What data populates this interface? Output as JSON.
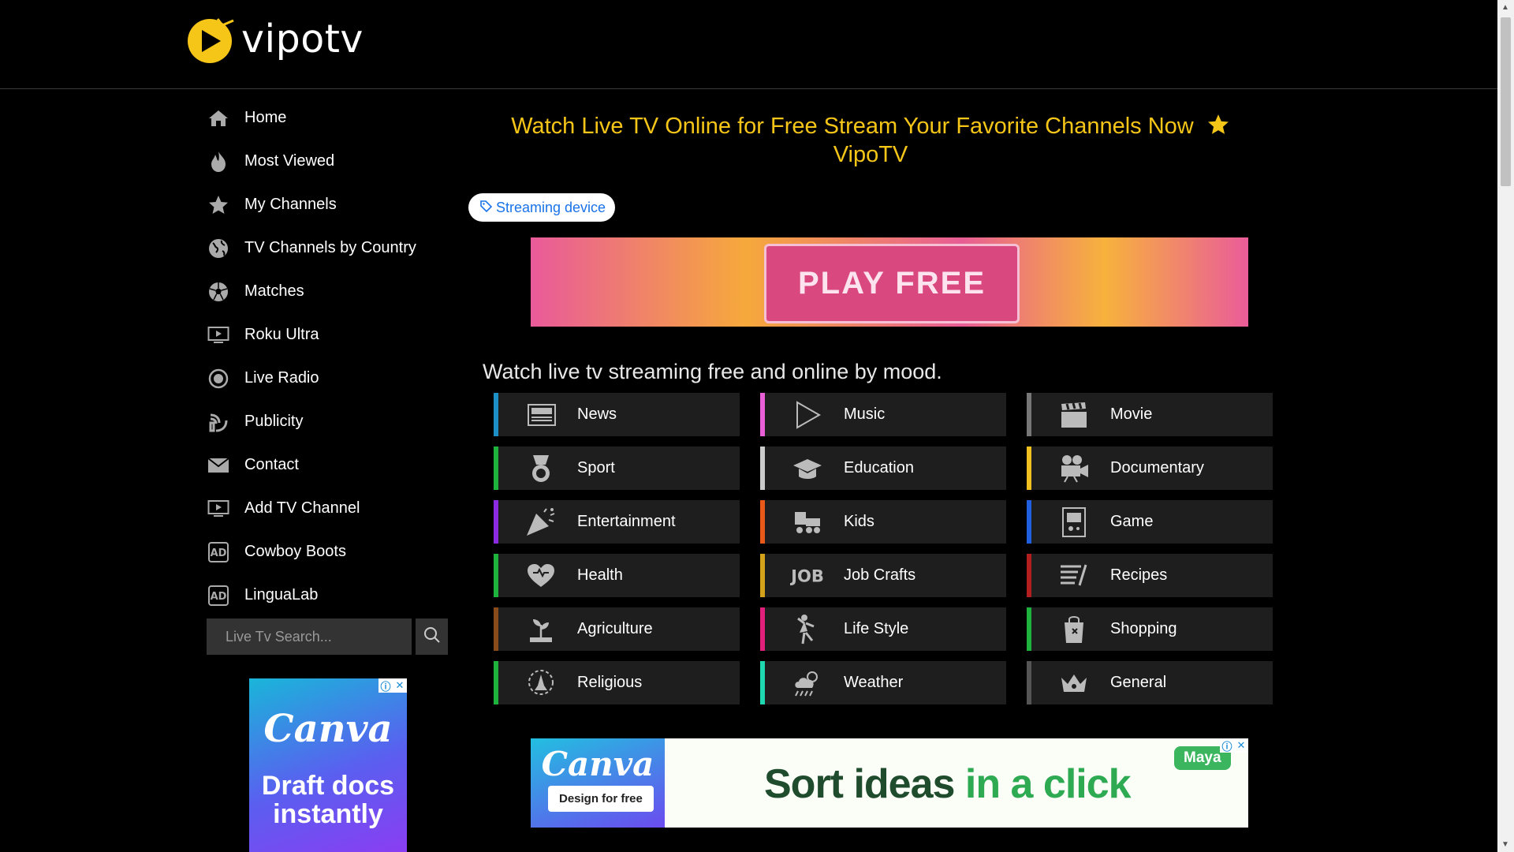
{
  "site": {
    "logo_text": "vipotv"
  },
  "sidebar": {
    "items": [
      {
        "label": "Home",
        "icon": "home-icon"
      },
      {
        "label": "Most Viewed",
        "icon": "fire-icon"
      },
      {
        "label": "My Channels",
        "icon": "star-icon"
      },
      {
        "label": "TV Channels by Country",
        "icon": "globe-icon"
      },
      {
        "label": "Matches",
        "icon": "soccer-ball-icon"
      },
      {
        "label": "Roku Ultra",
        "icon": "tv-play-icon"
      },
      {
        "label": "Live Radio",
        "icon": "radio-icon"
      },
      {
        "label": "Publicity",
        "icon": "publicity-icon"
      },
      {
        "label": "Contact",
        "icon": "envelope-icon"
      },
      {
        "label": "Add TV Channel",
        "icon": "tv-play-icon"
      },
      {
        "label": "Cowboy Boots",
        "icon": "ad-icon"
      },
      {
        "label": "LinguaLab",
        "icon": "ad-icon"
      }
    ]
  },
  "search": {
    "placeholder": "Live Tv Search..."
  },
  "main": {
    "title_line1": "Watch Live TV Online for Free Stream Your Favorite Channels Now",
    "title_line2": "VipoTV",
    "tag_label": "Streaming device",
    "section_title": "Watch live tv streaming free and online by mood."
  },
  "ads": {
    "top_banner_text": "PLAY FREE",
    "side_brand": "Canva",
    "side_text": "Draft docs instantly",
    "bottom_brand": "Canva",
    "bottom_cta": "Design for free",
    "bottom_slogan_a": "Sort ideas",
    "bottom_slogan_b": "in a click",
    "bottom_tag": "Maya"
  },
  "categories": [
    {
      "label": "News",
      "color": "#1e90c8",
      "icon": "newspaper-icon"
    },
    {
      "label": "Music",
      "color": "#e85fd8",
      "icon": "play-triangle-icon"
    },
    {
      "label": "Movie",
      "color": "#777777",
      "icon": "clapperboard-icon"
    },
    {
      "label": "Sport",
      "color": "#1db33c",
      "icon": "medal-icon"
    },
    {
      "label": "Education",
      "color": "#cccccc",
      "icon": "graduation-cap-icon"
    },
    {
      "label": "Documentary",
      "color": "#f0c020",
      "icon": "video-camera-icon"
    },
    {
      "label": "Entertainment",
      "color": "#8a2be2",
      "icon": "party-popper-icon"
    },
    {
      "label": "Kids",
      "color": "#e8591a",
      "icon": "toy-train-icon"
    },
    {
      "label": "Game",
      "color": "#1f5fe0",
      "icon": "arcade-icon"
    },
    {
      "label": "Health",
      "color": "#1db33c",
      "icon": "heart-icon"
    },
    {
      "label": "Job Crafts",
      "color": "#d4a21a",
      "icon": "job-icon"
    },
    {
      "label": "Recipes",
      "color": "#b31f1f",
      "icon": "recipe-list-icon"
    },
    {
      "label": "Agriculture",
      "color": "#8a4b1a",
      "icon": "sprout-icon"
    },
    {
      "label": "Life Style",
      "color": "#e0207a",
      "icon": "dancer-icon"
    },
    {
      "label": "Shopping",
      "color": "#1db33c",
      "icon": "shopping-bag-icon"
    },
    {
      "label": "Religious",
      "color": "#1db33c",
      "icon": "praying-hands-icon"
    },
    {
      "label": "Weather",
      "color": "#20d8b0",
      "icon": "weather-cloud-icon"
    },
    {
      "label": "General",
      "color": "#555555",
      "icon": "crown-icon"
    }
  ],
  "colors": {
    "accent": "#f5c518",
    "background": "#000000",
    "tile": "#1e1e1e"
  }
}
